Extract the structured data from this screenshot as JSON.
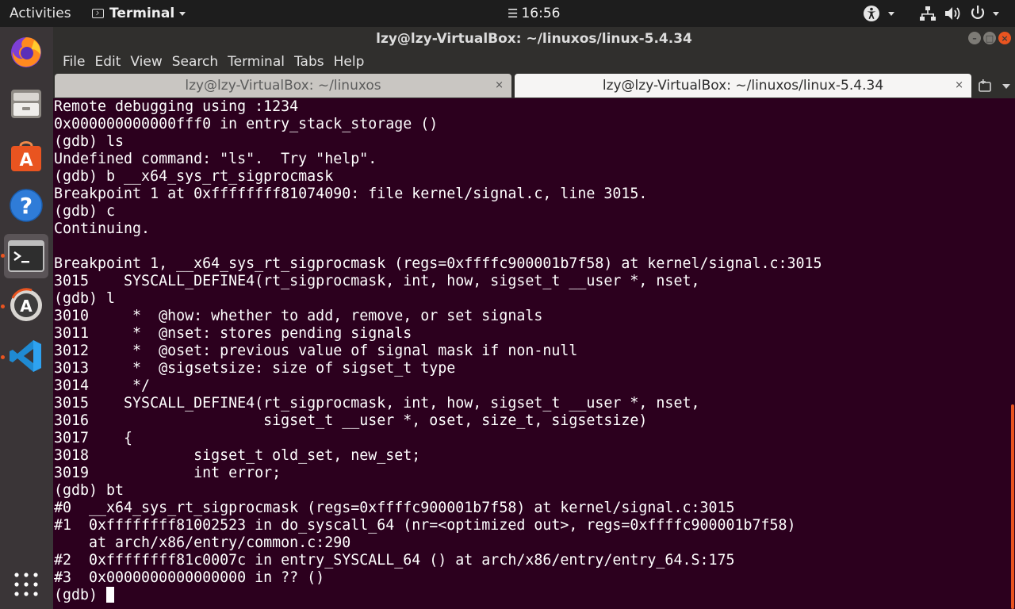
{
  "topbar": {
    "activities": "Activities",
    "app_name": "Terminal",
    "clock_icon": "☰",
    "clock": "16:56"
  },
  "dock": {
    "items": [
      {
        "name": "firefox",
        "icon": "firefox-icon"
      },
      {
        "name": "files",
        "icon": "files-icon"
      },
      {
        "name": "ubuntu-software",
        "icon": "software-center-icon"
      },
      {
        "name": "help",
        "icon": "help-icon"
      },
      {
        "name": "terminal",
        "icon": "terminal-icon",
        "active": true
      },
      {
        "name": "software-updater",
        "icon": "software-updater-icon"
      },
      {
        "name": "vscode",
        "icon": "vscode-icon"
      }
    ],
    "show_apps": "show-applications-icon"
  },
  "window": {
    "title": "lzy@lzy-VirtualBox: ~/linuxos/linux-5.4.34"
  },
  "menu": [
    "File",
    "Edit",
    "View",
    "Search",
    "Terminal",
    "Tabs",
    "Help"
  ],
  "tabs": [
    {
      "label": "lzy@lzy-VirtualBox: ~/linuxos",
      "active": false,
      "close": "×"
    },
    {
      "label": "lzy@lzy-VirtualBox: ~/linuxos/linux-5.4.34",
      "active": true,
      "close": "×"
    }
  ],
  "terminal": {
    "lines": [
      "Remote debugging using :1234",
      "0x000000000000fff0 in entry_stack_storage ()",
      "(gdb) ls",
      "Undefined command: \"ls\".  Try \"help\".",
      "(gdb) b __x64_sys_rt_sigprocmask",
      "Breakpoint 1 at 0xffffffff81074090: file kernel/signal.c, line 3015.",
      "(gdb) c",
      "Continuing.",
      "",
      "Breakpoint 1, __x64_sys_rt_sigprocmask (regs=0xffffc900001b7f58) at kernel/signal.c:3015",
      "3015    SYSCALL_DEFINE4(rt_sigprocmask, int, how, sigset_t __user *, nset,",
      "(gdb) l",
      "3010     *  @how: whether to add, remove, or set signals",
      "3011     *  @nset: stores pending signals",
      "3012     *  @oset: previous value of signal mask if non-null",
      "3013     *  @sigsetsize: size of sigset_t type",
      "3014     */",
      "3015    SYSCALL_DEFINE4(rt_sigprocmask, int, how, sigset_t __user *, nset,",
      "3016                    sigset_t __user *, oset, size_t, sigsetsize)",
      "3017    {",
      "3018            sigset_t old_set, new_set;",
      "3019            int error;",
      "(gdb) bt",
      "#0  __x64_sys_rt_sigprocmask (regs=0xffffc900001b7f58) at kernel/signal.c:3015",
      "#1  0xffffffff81002523 in do_syscall_64 (nr=<optimized out>, regs=0xffffc900001b7f58)",
      "    at arch/x86/entry/common.c:290",
      "#2  0xffffffff81c0007c in entry_SYSCALL_64 () at arch/x86/entry/entry_64.S:175",
      "#3  0x0000000000000000 in ?? ()"
    ],
    "prompt": "(gdb) "
  },
  "colors": {
    "terminal_bg": "#2c001e",
    "accent": "#e95420",
    "topbar_bg": "#1d1d1d",
    "dock_bg": "#3a3537"
  }
}
